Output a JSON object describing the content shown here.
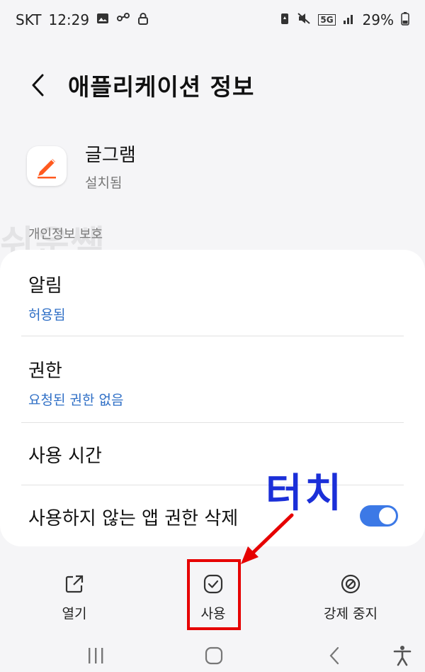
{
  "status_bar": {
    "carrier": "SKT",
    "time": "12:29",
    "network": "5G",
    "battery": "29%"
  },
  "header": {
    "title": "애플리케이션 정보"
  },
  "app": {
    "name": "글그램",
    "status": "설치됨",
    "icon_color": "#ff5a1f"
  },
  "section": {
    "label": "개인정보 보호"
  },
  "watermark": "쉬운쌤",
  "settings": {
    "notifications": {
      "title": "알림",
      "value": "허용됨"
    },
    "permissions": {
      "title": "권한",
      "value": "요청된 권한 없음"
    },
    "usage_time": {
      "title": "사용 시간"
    },
    "remove_unused": {
      "title": "사용하지 않는 앱 권한 삭제",
      "enabled": true
    }
  },
  "annotation": {
    "text": "터치",
    "color": "#1b2fd8"
  },
  "actions": {
    "open": "열기",
    "usage": "사용",
    "force_stop": "강제 중지"
  },
  "colors": {
    "accent": "#3c79e6",
    "link": "#2f6fc6",
    "highlight": "#e60000"
  }
}
